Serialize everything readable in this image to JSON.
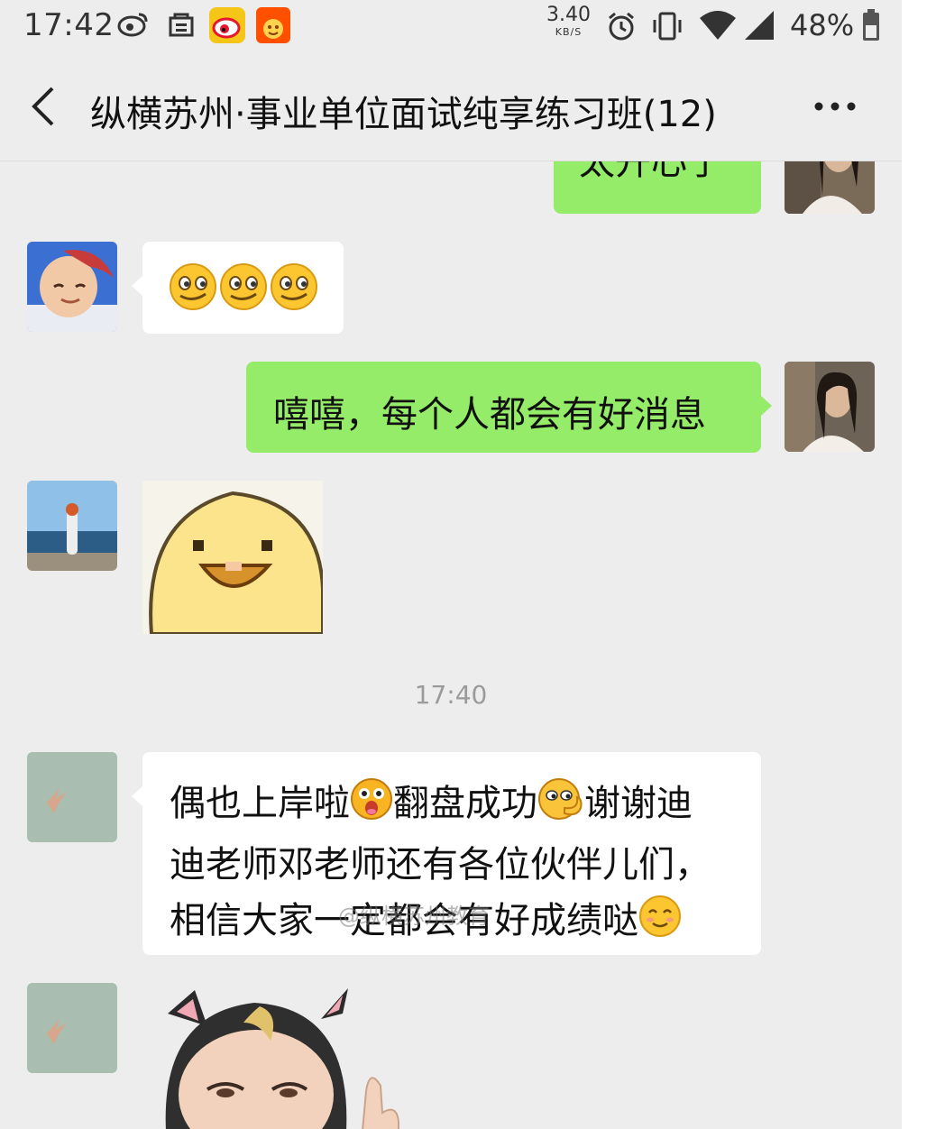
{
  "status_bar": {
    "time": "17:42",
    "net_speed_value": "3.40",
    "net_speed_unit": "KB/S",
    "battery_percent": "48%",
    "icons": [
      "weibo-icon",
      "store-icon",
      "weibo-red-app-icon",
      "taobao-app-icon",
      "alarm-icon",
      "vibrate-icon",
      "wifi-icon",
      "signal-icon",
      "battery-icon"
    ]
  },
  "header": {
    "title": "纵横苏州·事业单位面试纯享练习班(12)",
    "back_icon": "chevron-left-icon",
    "more_icon": "more-dots-icon"
  },
  "messages": [
    {
      "side": "out",
      "type": "text",
      "text": "太开心了"
    },
    {
      "side": "in",
      "type": "emoji",
      "emoji": "grinning-sly-emoji",
      "count": 3
    },
    {
      "side": "out",
      "type": "text",
      "text": "嘻嘻，每个人都会有好消息"
    },
    {
      "side": "in",
      "type": "sticker",
      "sticker": "laughing-chick-sticker"
    },
    {
      "side": "in",
      "type": "text",
      "lines": [
        {
          "parts": [
            "偶也上岸啦",
            "翻盘成功",
            "谢谢迪"
          ]
        },
        {
          "parts": [
            "迪老师邓老师还有各位伙伴儿们，"
          ]
        },
        {
          "parts": [
            "相信大家一定都会有好成绩哒"
          ]
        }
      ],
      "inline_emojis": [
        "surprised-emoji",
        "shy-emoji",
        "smile-emoji"
      ]
    },
    {
      "side": "in",
      "type": "sticker",
      "sticker": "cat-ear-baby-sticker"
    }
  ],
  "timestamp": "17:40",
  "watermark": "@纵横苏州教育",
  "colors": {
    "chat_background": "#ededed",
    "outgoing_bubble": "#95ec69",
    "incoming_bubble": "#ffffff"
  }
}
